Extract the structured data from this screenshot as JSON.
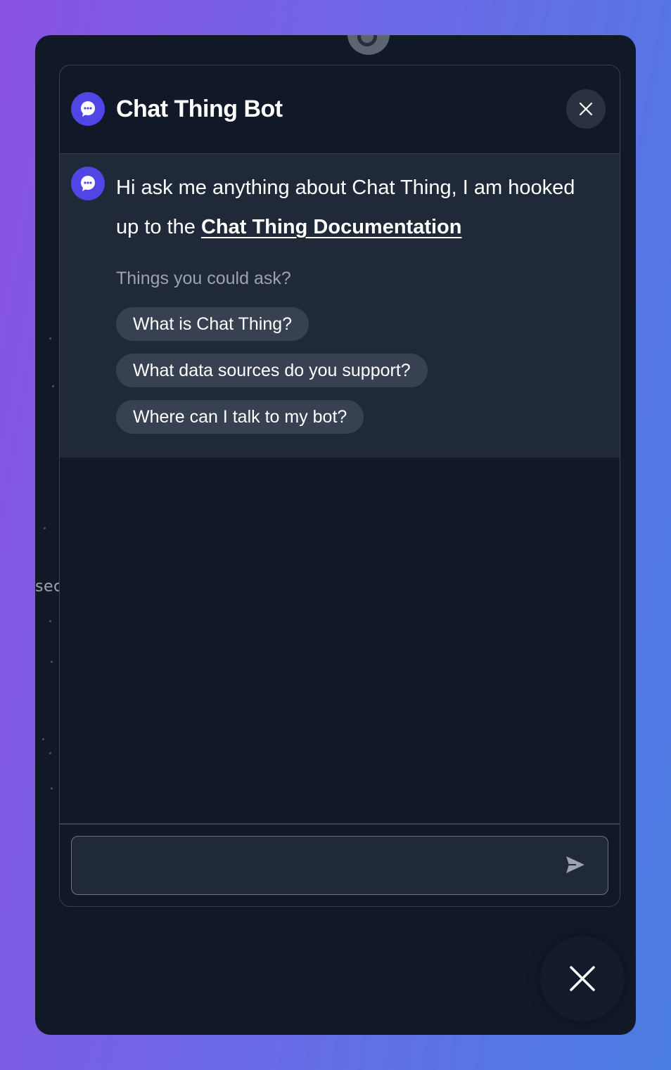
{
  "background_partial_text": "sec",
  "header": {
    "title": "Chat Thing Bot",
    "avatar_icon": "chat-bubble-icon",
    "close_icon": "close-icon"
  },
  "bot_message": {
    "text_before_link": "Hi ask me anything about Chat Thing, I am hooked up to the ",
    "link_text": "Chat Thing Documentation",
    "suggestions_label": "Things you could ask?",
    "suggestions": [
      "What is Chat Thing?",
      "What data sources do you support?",
      "Where can I talk to my bot?"
    ]
  },
  "composer": {
    "value": "",
    "placeholder": "",
    "send_icon": "send-icon"
  },
  "launcher": {
    "icon": "close-icon"
  },
  "colors": {
    "accent": "#4f46e5",
    "panel_bg": "#111827",
    "message_bg": "#1f2937",
    "chip_bg": "#374151",
    "muted_text": "#9ca3af"
  }
}
